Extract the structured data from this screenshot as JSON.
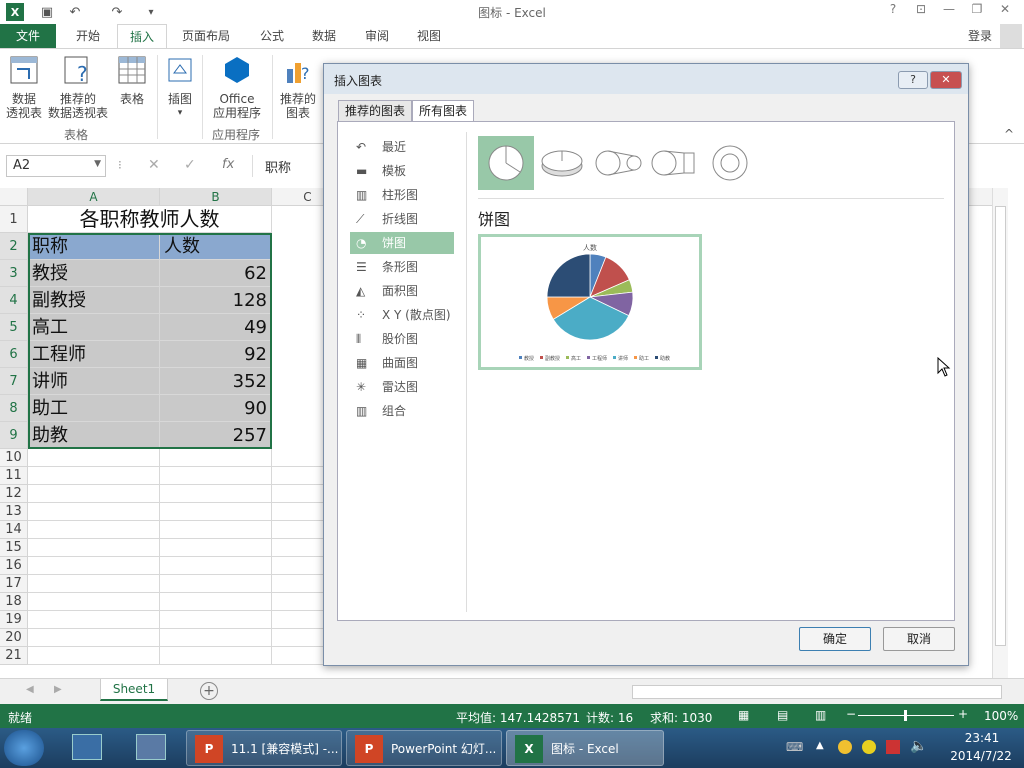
{
  "window": {
    "title": "图标 - Excel",
    "help": "?",
    "login": "登录"
  },
  "tabs": [
    "文件",
    "开始",
    "插入",
    "页面布局",
    "公式",
    "数据",
    "审阅",
    "视图"
  ],
  "ribbon": {
    "pivot": "数据\n透视表",
    "rec_pivot": "推荐的\n数据透视表",
    "table": "表格",
    "illust": "插图",
    "office": "Office\n应用程序",
    "rec_chart": "推荐的\n图表",
    "group_table": "表格",
    "group_apps": "应用程序"
  },
  "formula_bar": {
    "namebox": "A2",
    "fx": "fx",
    "content": "职称"
  },
  "sheet": {
    "columns": [
      "A",
      "B",
      "C"
    ],
    "title": "各职称教师人数",
    "header": [
      "职称",
      "人数"
    ],
    "rows": [
      [
        "教授",
        "62"
      ],
      [
        "副教授",
        "128"
      ],
      [
        "高工",
        "49"
      ],
      [
        "工程师",
        "92"
      ],
      [
        "讲师",
        "352"
      ],
      [
        "助工",
        "90"
      ],
      [
        "助教",
        "257"
      ]
    ],
    "row_numbers": [
      "1",
      "2",
      "3",
      "4",
      "5",
      "6",
      "7",
      "8",
      "9",
      "10",
      "11",
      "12",
      "13",
      "14",
      "15",
      "16",
      "17",
      "18",
      "19",
      "20",
      "21"
    ]
  },
  "dialog": {
    "title": "插入图表",
    "tab_recommended": "推荐的图表",
    "tab_all": "所有图表",
    "categories": [
      "最近",
      "模板",
      "柱形图",
      "折线图",
      "饼图",
      "条形图",
      "面积图",
      "X Y (散点图)",
      "股价图",
      "曲面图",
      "雷达图",
      "组合"
    ],
    "selected_heading": "饼图",
    "preview_title": "人数",
    "ok": "确定",
    "cancel": "取消"
  },
  "chart_data": {
    "type": "pie",
    "title": "人数",
    "categories": [
      "教授",
      "副教授",
      "高工",
      "工程师",
      "讲师",
      "助工",
      "助教"
    ],
    "values": [
      62,
      128,
      49,
      92,
      352,
      90,
      257
    ],
    "colors": [
      "#4f81bd",
      "#c0504d",
      "#9bbb59",
      "#8064a2",
      "#4bacc6",
      "#f79646",
      "#2c4d75"
    ],
    "legend": "bottom"
  },
  "sheettabs": {
    "sheet1": "Sheet1",
    "add": "+"
  },
  "status": {
    "ready": "就绪",
    "average": "平均值: 147.1428571",
    "count": "计数: 16",
    "sum": "求和: 1030",
    "zoom": "100%"
  },
  "taskbar": {
    "item1": "11.1 [兼容模式] -...",
    "item2": "PowerPoint 幻灯...",
    "item3": "图标 - Excel",
    "time": "23:41",
    "date": "2014/7/22"
  }
}
